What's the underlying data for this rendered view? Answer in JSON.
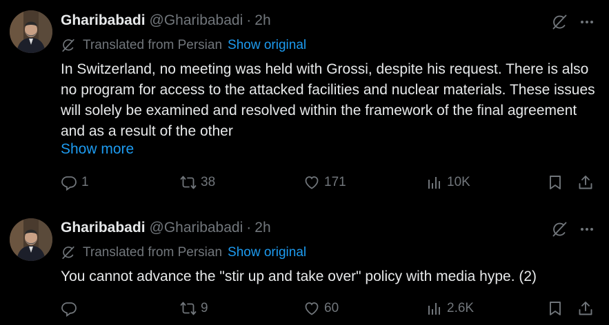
{
  "tweets": [
    {
      "author": {
        "name": "Gharibabadi",
        "handle": "@Gharibabadi",
        "separator": "·",
        "time": "2h"
      },
      "translation": {
        "label": "Translated from Persian",
        "link": "Show original"
      },
      "text": "In Switzerland, no meeting was held with Grossi, despite his request. There is also no program for access to the attacked facilities and nuclear materials. These issues will solely be examined and resolved within the framework of the final agreement and as a result of the other",
      "show_more": "Show more",
      "stats": {
        "replies": "1",
        "reposts": "38",
        "likes": "171",
        "views": "10K"
      }
    },
    {
      "author": {
        "name": "Gharibabadi",
        "handle": "@Gharibabadi",
        "separator": "·",
        "time": "2h"
      },
      "translation": {
        "label": "Translated from Persian",
        "link": "Show original"
      },
      "text": "You cannot advance the \"stir up and take over\" policy with media hype. (2)",
      "stats": {
        "replies": "",
        "reposts": "9",
        "likes": "60",
        "views": "2.6K"
      }
    }
  ],
  "icons": [
    "grok-icon",
    "more-icon",
    "globe-icon",
    "reply-icon",
    "repost-icon",
    "like-icon",
    "views-icon",
    "bookmark-icon",
    "share-icon"
  ],
  "colors": {
    "background": "#000000",
    "text": "#e7e9ea",
    "muted": "#71767b",
    "link": "#1d9bf0",
    "thread_line": "#333639"
  }
}
